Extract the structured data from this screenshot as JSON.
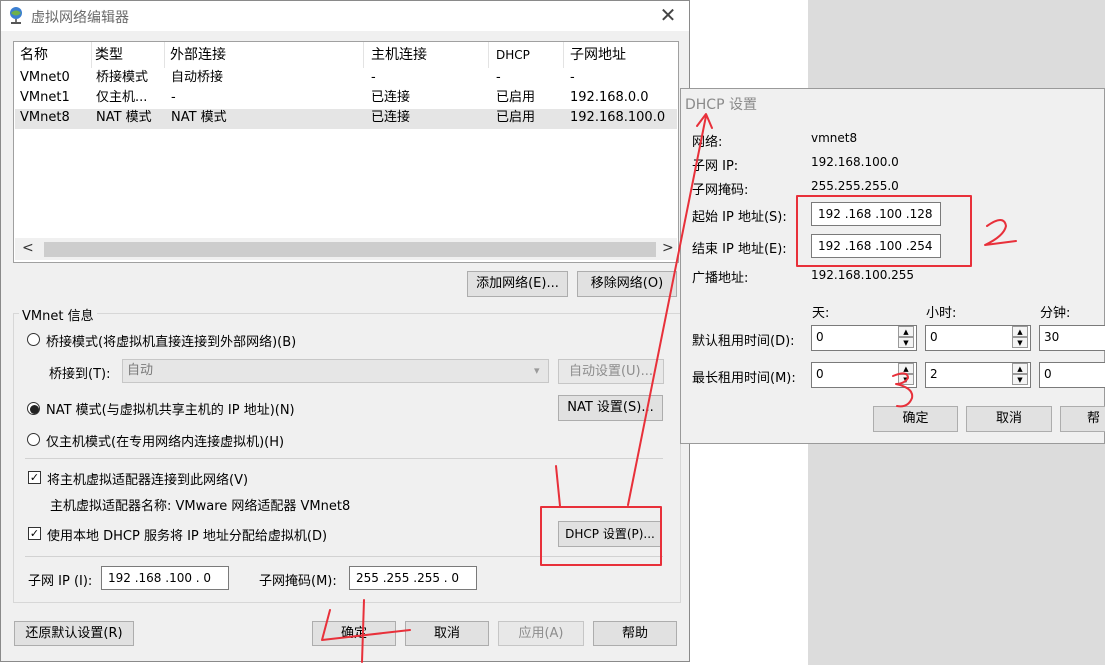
{
  "window": {
    "title": "虚拟网络编辑器",
    "close_glyph": "✕"
  },
  "network_list": {
    "columns": [
      "名称",
      "类型",
      "外部连接",
      "主机连接",
      "DHCP",
      "子网地址"
    ],
    "rows": [
      [
        "VMnet0",
        "桥接模式",
        "自动桥接",
        "-",
        "-",
        "-"
      ],
      [
        "VMnet1",
        "仅主机...",
        "-",
        "已连接",
        "已启用",
        "192.168.0.0"
      ],
      [
        "VMnet8",
        "NAT 模式",
        "NAT 模式",
        "已连接",
        "已启用",
        "192.168.100.0"
      ]
    ],
    "scroll_left": "<",
    "scroll_right": ">"
  },
  "list_buttons": {
    "add": "添加网络(E)...",
    "remove": "移除网络(O)"
  },
  "vmnet_info": {
    "group_label": "VMnet 信息",
    "bridge_mode": "桥接模式(将虚拟机直接连接到外部网络)(B)",
    "bridge_to_label": "桥接到(T):",
    "bridge_to_value": "自动",
    "auto_settings": "自动设置(U)...",
    "nat_mode": "NAT 模式(与虚拟机共享主机的 IP 地址)(N)",
    "nat_settings": "NAT 设置(S)...",
    "host_only": "仅主机模式(在专用网络内连接虚拟机)(H)",
    "connect_adapter": "将主机虚拟适配器连接到此网络(V)",
    "adapter_name": "主机虚拟适配器名称: VMware 网络适配器 VMnet8",
    "use_dhcp": "使用本地 DHCP 服务将 IP 地址分配给虚拟机(D)",
    "dhcp_settings": "DHCP 设置(P)...",
    "subnet_ip_label": "子网 IP (I):",
    "subnet_ip": "192 .168 .100 .  0",
    "subnet_mask_label": "子网掩码(M):",
    "subnet_mask": "255 .255 .255 .  0",
    "check_mark": "✓"
  },
  "footer": {
    "restore": "还原默认设置(R)",
    "ok": "确定",
    "cancel": "取消",
    "apply": "应用(A)",
    "help": "帮助"
  },
  "dhcp_dialog": {
    "title": "DHCP 设置",
    "network_label": "网络:",
    "network_value": "vmnet8",
    "subnet_ip_label": "子网 IP:",
    "subnet_ip_value": "192.168.100.0",
    "subnet_mask_label": "子网掩码:",
    "subnet_mask_value": "255.255.255.0",
    "start_ip_label": "起始 IP 地址(S):",
    "start_ip": "192 .168 .100 .128",
    "end_ip_label": "结束 IP 地址(E):",
    "end_ip": "192 .168 .100 .254",
    "broadcast_label": "广播地址:",
    "broadcast_value": "192.168.100.255",
    "col_days": "天:",
    "col_hours": "小时:",
    "col_minutes": "分钟:",
    "default_lease_label": "默认租用时间(D):",
    "default_lease": [
      "0",
      "0",
      "30"
    ],
    "max_lease_label": "最长租用时间(M):",
    "max_lease": [
      "0",
      "2",
      "0"
    ],
    "ok": "确定",
    "cancel": "取消",
    "help": "帮",
    "spin_up": "▲",
    "spin_down": "▼"
  },
  "annotations": {
    "color": "#e8303a"
  }
}
